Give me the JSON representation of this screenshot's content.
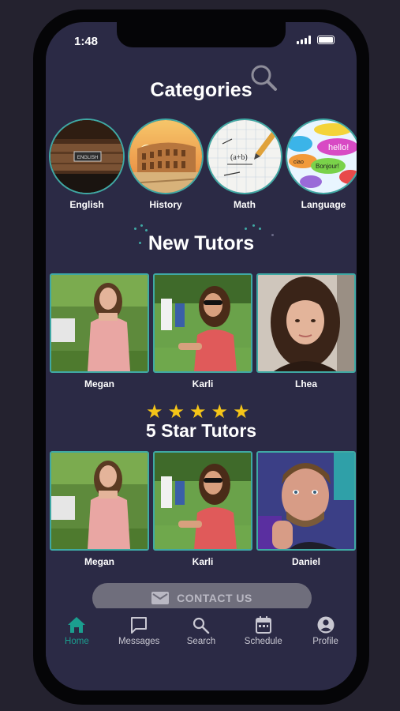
{
  "status_bar": {
    "time": "1:48"
  },
  "categories": {
    "title": "Categories",
    "items": [
      {
        "label": "English"
      },
      {
        "label": "History"
      },
      {
        "label": "Math"
      },
      {
        "label": "Language"
      }
    ],
    "image_text": {
      "english_sign": "ENGLISH",
      "math_note": "(a+b)",
      "hello": "hello!",
      "bonjour": "Bonjour!",
      "ciao": "ciao"
    }
  },
  "new_tutors": {
    "title": "New Tutors",
    "items": [
      {
        "name": "Megan"
      },
      {
        "name": "Karli"
      },
      {
        "name": "Lhea"
      }
    ]
  },
  "five_star": {
    "title": "5 Star Tutors",
    "rating": 5,
    "items": [
      {
        "name": "Megan"
      },
      {
        "name": "Karli"
      },
      {
        "name": "Daniel"
      }
    ]
  },
  "contact": {
    "label": "CONTACT US"
  },
  "nav": {
    "items": [
      {
        "label": "Home",
        "icon": "home-icon",
        "active": true
      },
      {
        "label": "Messages",
        "icon": "message-icon"
      },
      {
        "label": "Search",
        "icon": "search-icon"
      },
      {
        "label": "Schedule",
        "icon": "calendar-icon"
      },
      {
        "label": "Profile",
        "icon": "profile-icon"
      }
    ]
  },
  "colors": {
    "background": "#2b2a45",
    "accent": "#3fa9a4",
    "active_nav": "#1b9e8f",
    "star": "#f5c518"
  }
}
